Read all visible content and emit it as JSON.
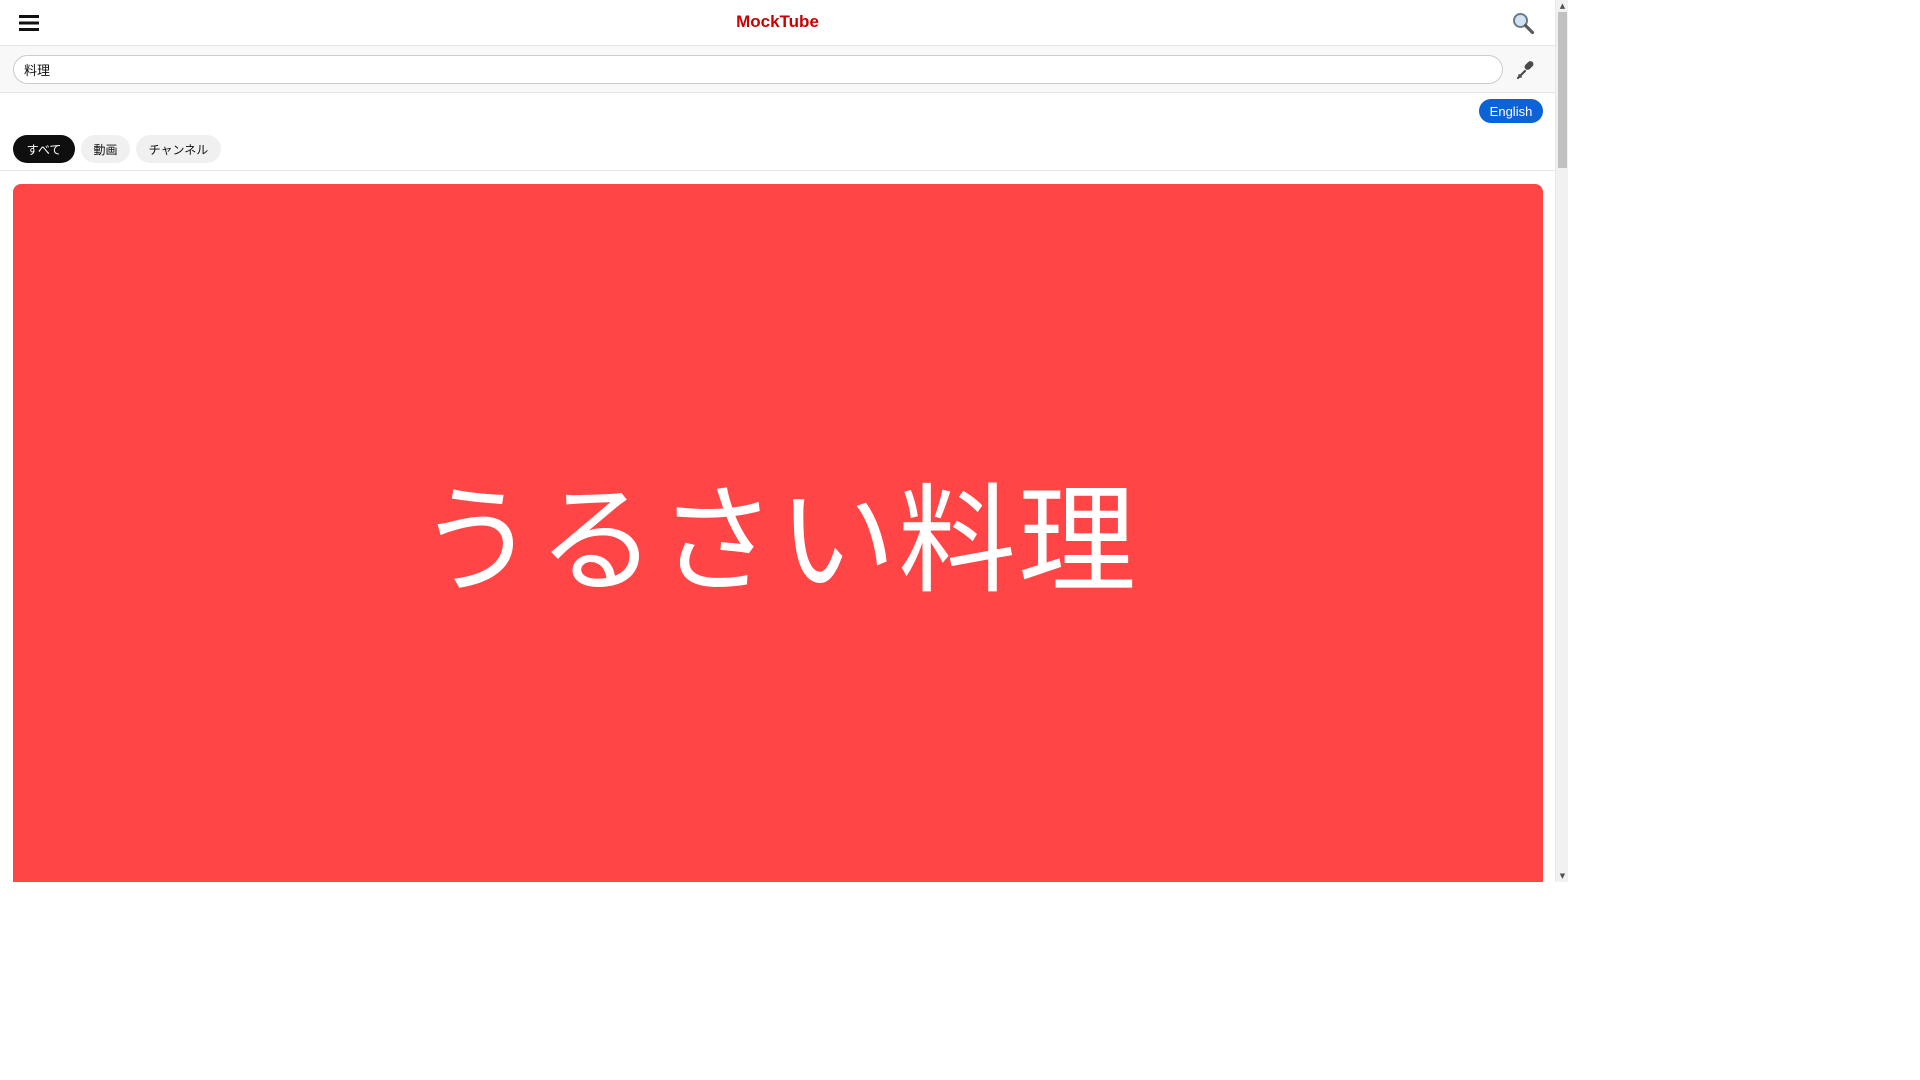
{
  "app": {
    "title": "MockTube",
    "brand_color": "#cc0000"
  },
  "header": {
    "menu_icon": "hamburger-menu-icon",
    "search_icon": "search-icon"
  },
  "search": {
    "value": "料理",
    "placeholder": "",
    "mic_icon": "microphone-icon"
  },
  "language": {
    "label": "English",
    "color": "#0b63d6"
  },
  "filters": {
    "items": [
      {
        "label": "すべて",
        "active": true
      },
      {
        "label": "動画",
        "active": false
      },
      {
        "label": "チャンネル",
        "active": false
      }
    ]
  },
  "results": {
    "items": [
      {
        "thumbnail_text": "うるさい料理",
        "thumbnail_color": "#ff4545"
      }
    ]
  }
}
